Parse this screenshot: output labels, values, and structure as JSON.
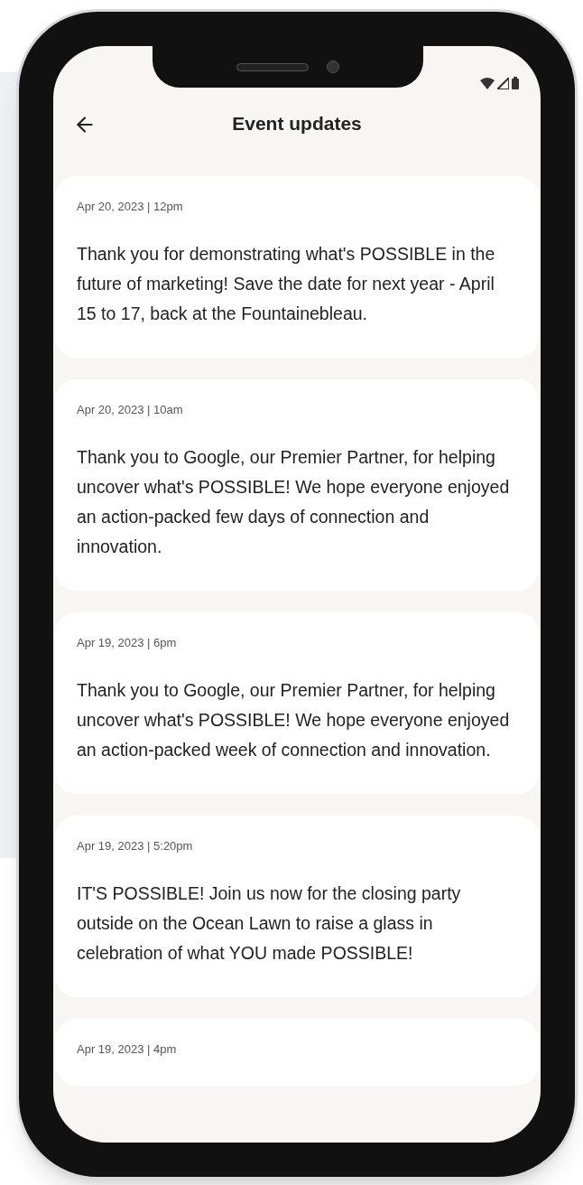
{
  "header": {
    "title": "Event updates"
  },
  "updates": [
    {
      "timestamp": "Apr 20, 2023 | 12pm",
      "message": "Thank you for demonstrating what's POSSIBLE in the future of marketing! Save the date for next year - April 15 to 17, back at the Fountainebleau."
    },
    {
      "timestamp": "Apr 20, 2023 | 10am",
      "message": "Thank you to Google, our Premier Partner, for helping uncover what's POSSIBLE! We hope everyone enjoyed an action-packed few days of connection and innovation."
    },
    {
      "timestamp": "Apr 19, 2023 | 6pm",
      "message": "Thank you to Google, our Premier Partner, for helping uncover what's POSSIBLE! We hope everyone enjoyed an action-packed week of connection and innovation."
    },
    {
      "timestamp": "Apr 19, 2023 | 5:20pm",
      "message": "IT'S POSSIBLE! Join us now for the closing party outside on the Ocean Lawn to raise a glass in celebration of what YOU made POSSIBLE!"
    },
    {
      "timestamp": "Apr 19, 2023 | 4pm"
    }
  ]
}
